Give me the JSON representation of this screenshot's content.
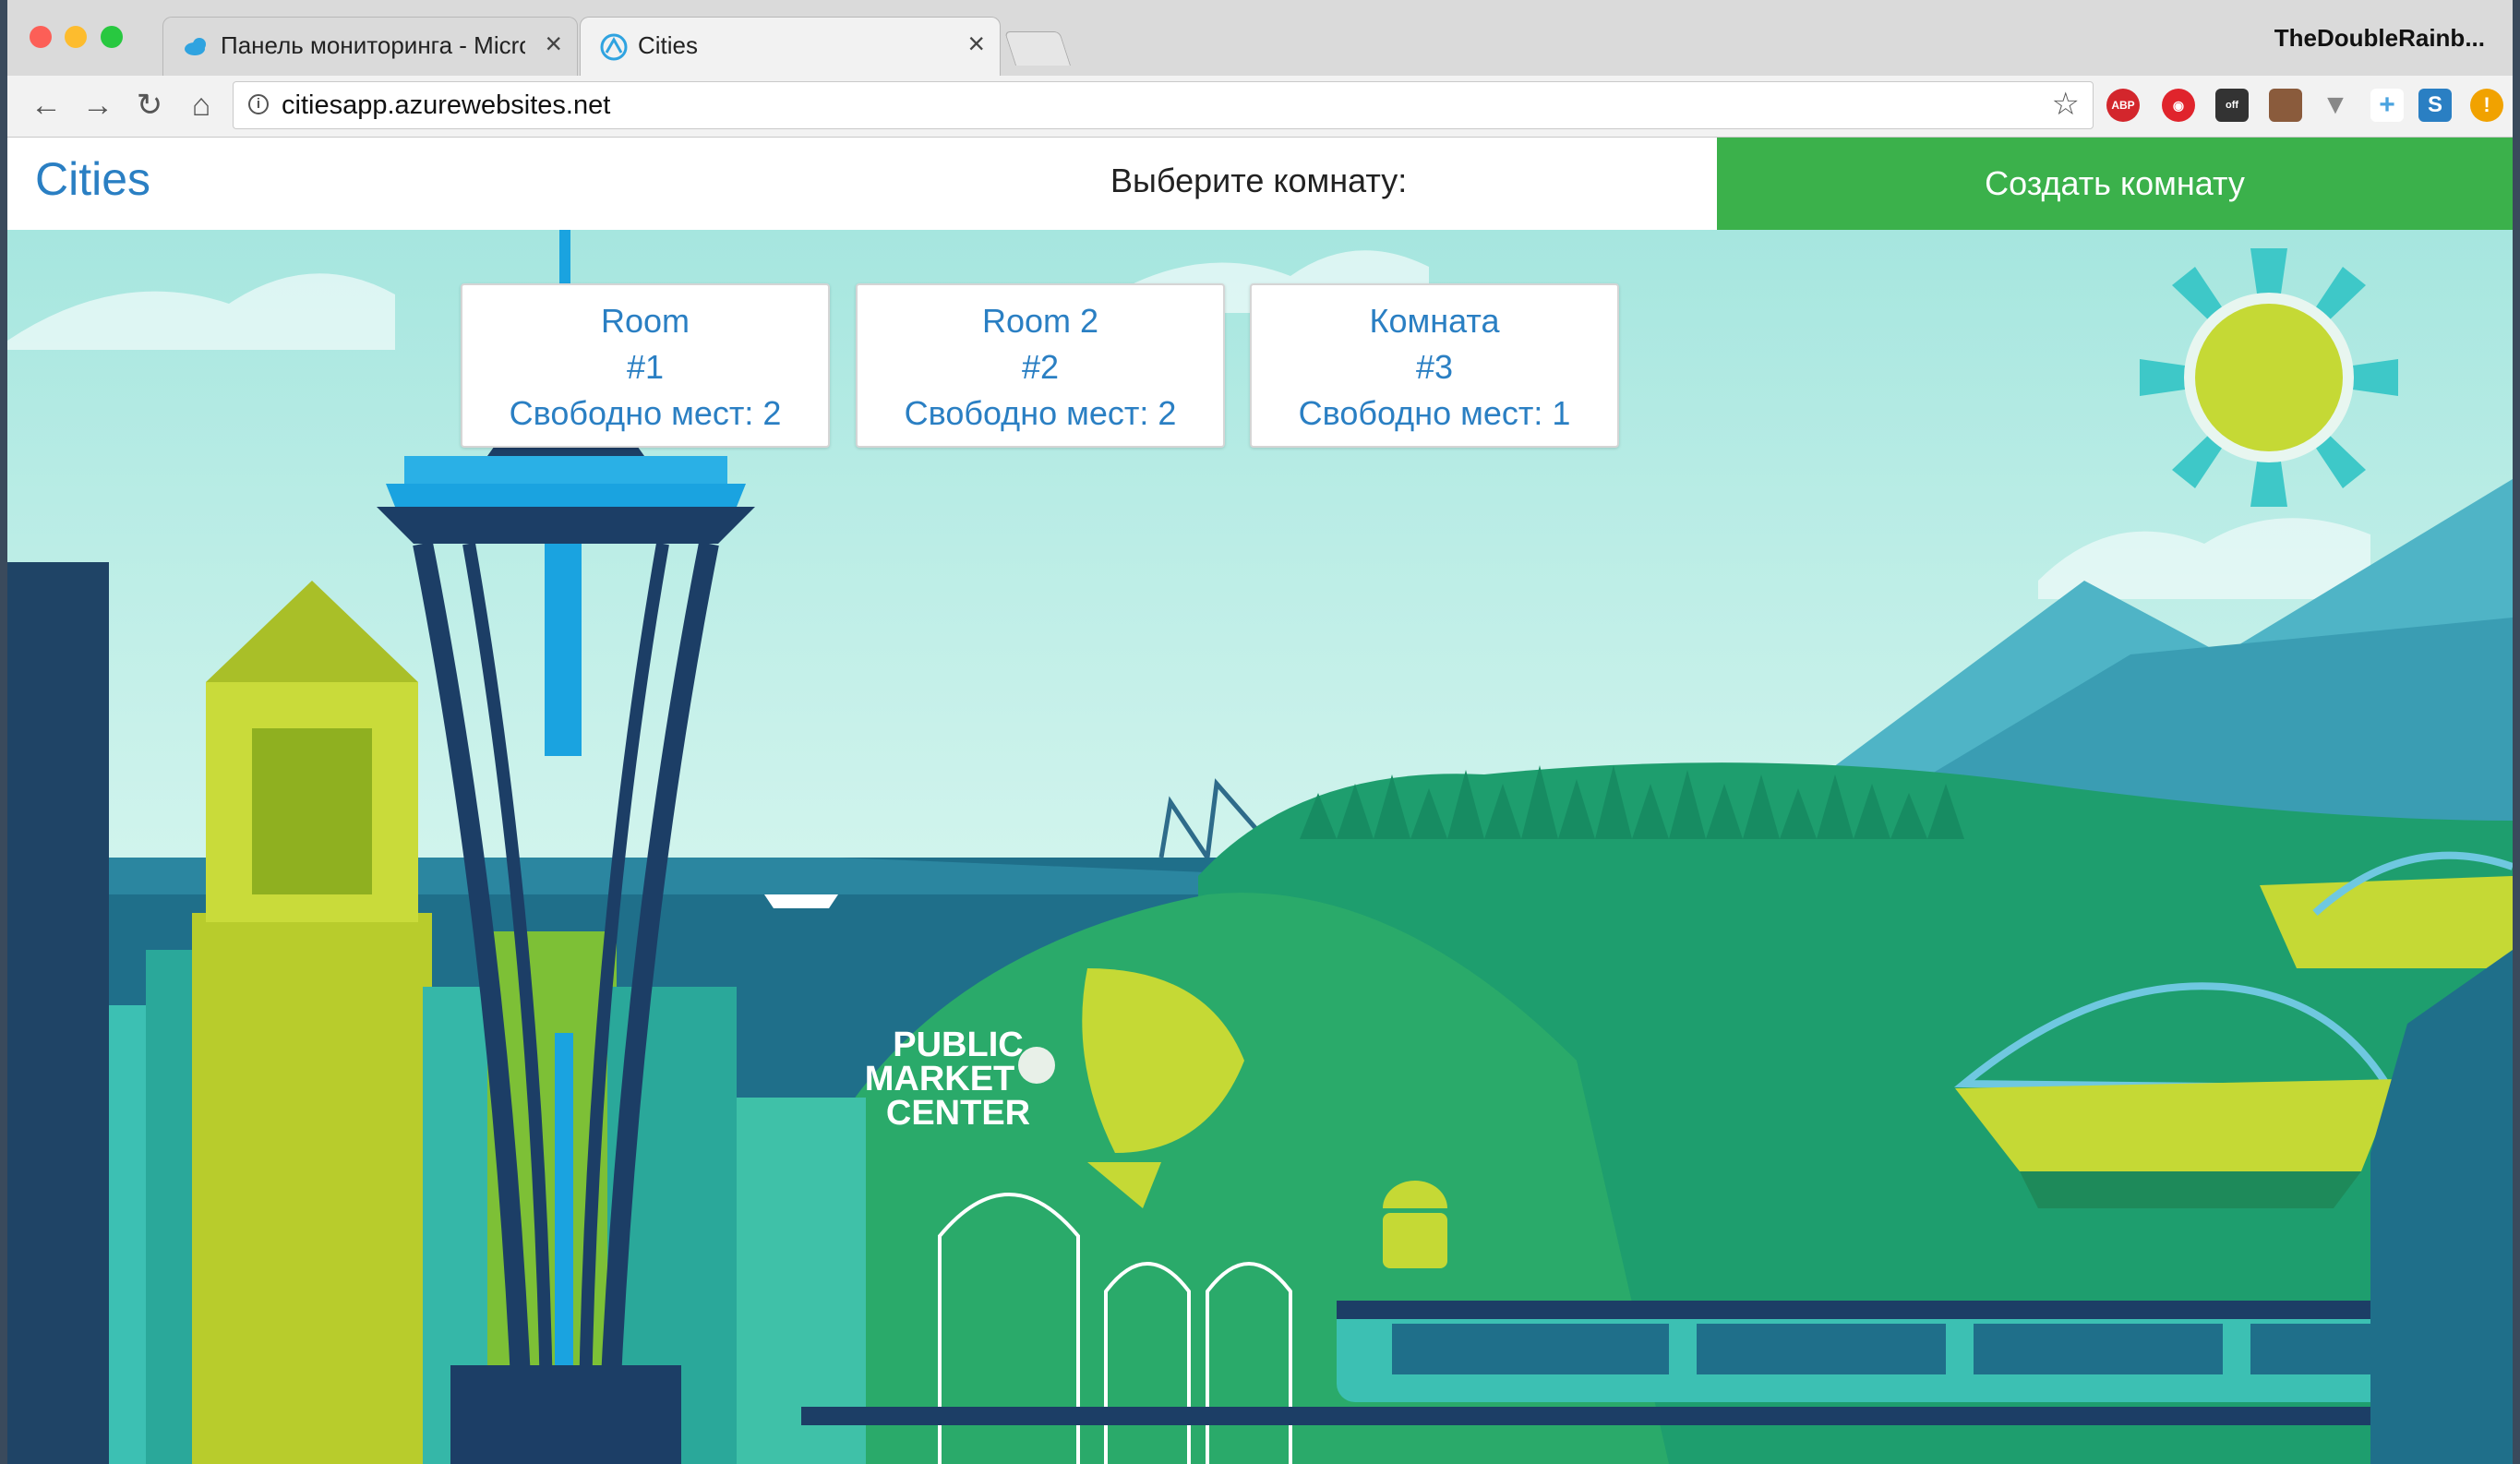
{
  "browser": {
    "tabs": [
      {
        "title": "Панель мониторинга - Micros",
        "icon": "azure-cloud-icon",
        "active": false
      },
      {
        "title": "Cities",
        "icon": "cities-app-icon",
        "active": true
      }
    ],
    "close_glyph": "×",
    "profile_name": "TheDoubleRainb...",
    "url": "citiesapp.azurewebsites.net",
    "extensions": {
      "abp": "ABP",
      "off": "off",
      "s": "S",
      "warn": "!"
    }
  },
  "navbar": {
    "brand": "Cities",
    "choose_label": "Выберите комнату:",
    "create_button": "Создать комнату"
  },
  "rooms": [
    {
      "name": "Room",
      "number": "#1",
      "free": "Свободно мест: 2"
    },
    {
      "name": "Room 2",
      "number": "#2",
      "free": "Свободно мест: 2"
    },
    {
      "name": "Комната",
      "number": "#3",
      "free": "Свободно мест: 1"
    }
  ],
  "illustration": {
    "market_sign": [
      "PUBLIC",
      "MARKET",
      "CENTER"
    ]
  },
  "colors": {
    "brand_blue": "#2a7fc3",
    "create_green": "#3bb14b",
    "sky": "#bff0ea",
    "forest": "#1e9e6e"
  }
}
